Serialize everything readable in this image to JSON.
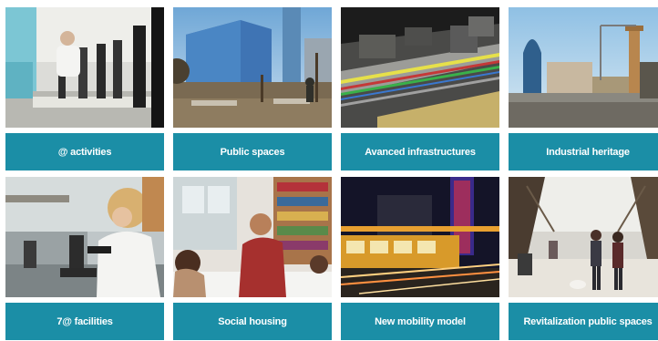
{
  "theme": {
    "label_bg": "#1b8ea6",
    "label_text": "#ffffff"
  },
  "tiles": [
    {
      "label": "@ activities",
      "image": "office-workers-image"
    },
    {
      "label": "Public spaces",
      "image": "public-space-buildings-image"
    },
    {
      "label": "Avanced infrastructures",
      "image": "infrastructure-3d-render-image"
    },
    {
      "label": "Industrial heritage",
      "image": "industrial-chimney-tower-image"
    },
    {
      "label": "7@ facilities",
      "image": "laboratory-microscope-image"
    },
    {
      "label": "Social housing",
      "image": "social-housing-interior-image"
    },
    {
      "label": "New  mobility model",
      "image": "tram-night-image"
    },
    {
      "label": "Revitalization public spaces",
      "image": "pedestrian-street-image"
    }
  ]
}
